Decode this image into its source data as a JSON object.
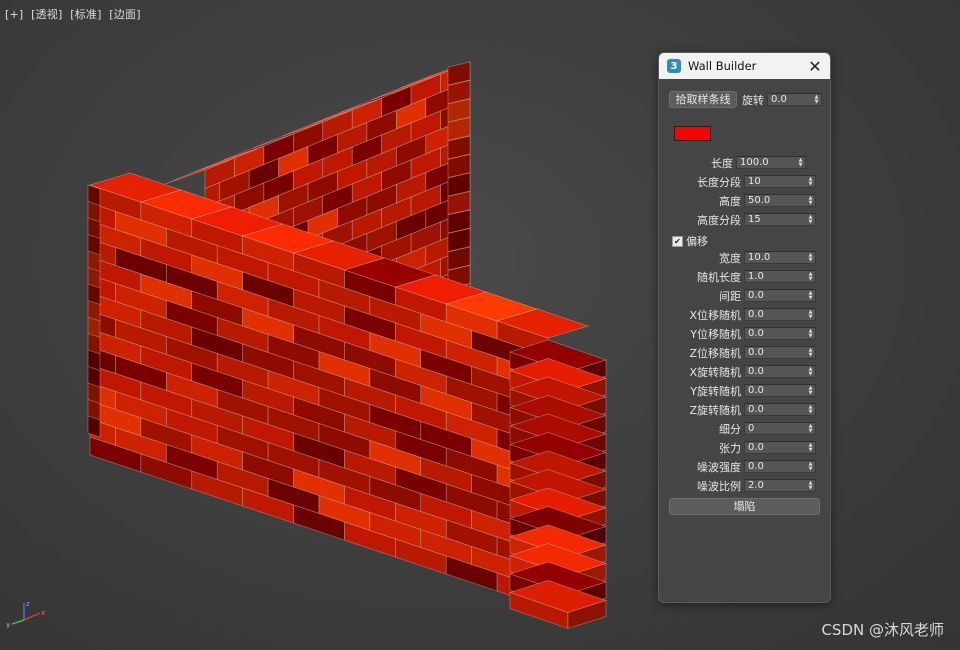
{
  "viewport": {
    "labels": [
      "[+]",
      "[透视]",
      "[标准]",
      "[边面]"
    ]
  },
  "colors": {
    "brick_color": "#ff0000",
    "brick_palette": [
      "#7a0000",
      "#8e0b00",
      "#a01200",
      "#b81a00",
      "#cc2200",
      "#e03000",
      "#6a0000",
      "#c01800"
    ]
  },
  "panel": {
    "title": "Wall Builder",
    "icon_text": "3",
    "pick_spline_label": "拾取样条线",
    "rotation_label": "旋转",
    "rotation_value": "0.0",
    "offset_checkbox_label": "偏移",
    "offset_checked": true,
    "collapse_label": "塌陷",
    "params_top": [
      {
        "label": "长度",
        "value": "100.0"
      },
      {
        "label": "长度分段",
        "value": "10"
      },
      {
        "label": "高度",
        "value": "50.0"
      },
      {
        "label": "高度分段",
        "value": "15"
      }
    ],
    "params_bottom": [
      {
        "label": "宽度",
        "value": "10.0"
      },
      {
        "label": "随机长度",
        "value": "1.0"
      },
      {
        "label": "间距",
        "value": "0.0"
      },
      {
        "label": "X位移随机",
        "value": "0.0"
      },
      {
        "label": "Y位移随机",
        "value": "0.0"
      },
      {
        "label": "Z位移随机",
        "value": "0.0"
      },
      {
        "label": "X旋转随机",
        "value": "0.0"
      },
      {
        "label": "Y旋转随机",
        "value": "0.0"
      },
      {
        "label": "Z旋转随机",
        "value": "0.0"
      },
      {
        "label": "细分",
        "value": "0"
      },
      {
        "label": "张力",
        "value": "0.0"
      },
      {
        "label": "噪波强度",
        "value": "0.0"
      },
      {
        "label": "噪波比例",
        "value": "2.0"
      }
    ]
  },
  "gizmo": {
    "x": "x",
    "y": "y",
    "z": "z"
  },
  "watermark": "CSDN @沐风老师"
}
